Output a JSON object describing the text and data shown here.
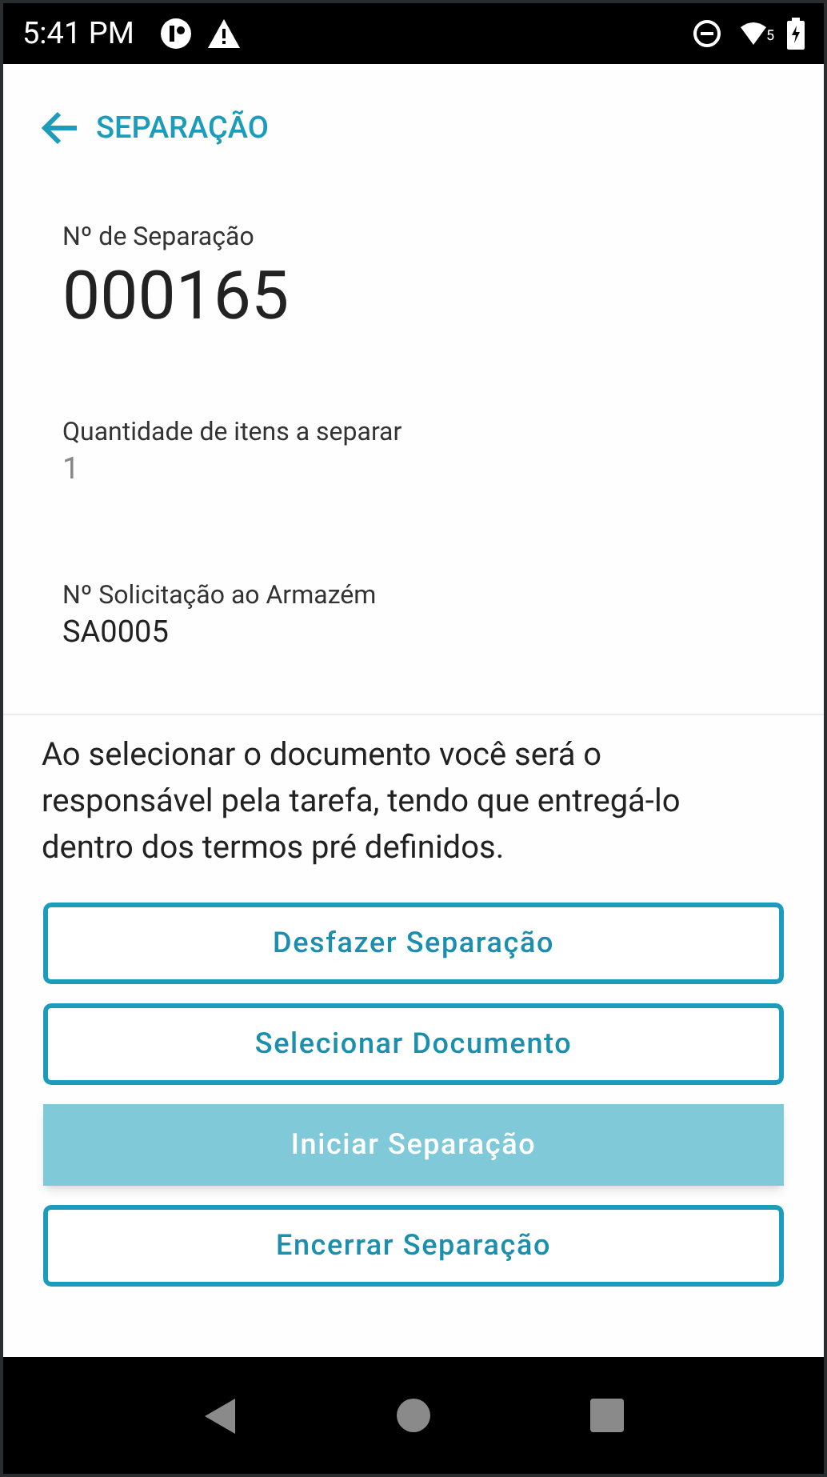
{
  "status_bar": {
    "time": "5:41 PM",
    "wifi_badge": "5"
  },
  "header": {
    "title": "SEPARAÇÃO"
  },
  "fields": [
    {
      "label": "Nº de Separação",
      "value": "000165",
      "kind": "headline"
    },
    {
      "label": "Quantidade de itens a separar",
      "value": "1",
      "kind": "muted"
    },
    {
      "label": "Nº Solicitação ao Armazém",
      "value": "SA0005",
      "kind": "normal"
    }
  ],
  "notice": "Ao selecionar o documento você será o responsável pela tarefa, tendo que entregá-lo dentro dos termos pré definidos.",
  "buttons": [
    {
      "label": "Desfazer Separação",
      "kind": "outlined"
    },
    {
      "label": "Selecionar Documento",
      "kind": "outlined"
    },
    {
      "label": "Iniciar Separação",
      "kind": "contained"
    },
    {
      "label": "Encerrar Separação",
      "kind": "outlined"
    }
  ]
}
